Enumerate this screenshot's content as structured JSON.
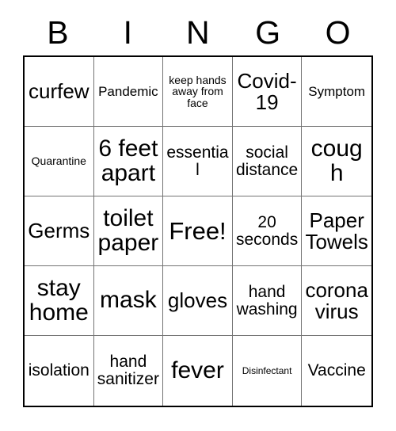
{
  "header": {
    "letters": [
      "B",
      "I",
      "N",
      "G",
      "O"
    ]
  },
  "grid": {
    "rows": 5,
    "columns": 5,
    "border_color": "#000000",
    "gridline_color": "#737373",
    "background": "#ffffff",
    "text_color": "#000000",
    "cells": [
      {
        "text": "curfew",
        "size": "s-lg"
      },
      {
        "text": "Pandemic",
        "size": "s-sm"
      },
      {
        "text": "keep hands away from face",
        "size": "s-xs"
      },
      {
        "text": "Covid-19",
        "size": "s-lg"
      },
      {
        "text": "Symptom",
        "size": "s-sm"
      },
      {
        "text": "Quarantine",
        "size": "s-xs"
      },
      {
        "text": "6 feet apart",
        "size": "s-xl"
      },
      {
        "text": "essential",
        "size": "s-md"
      },
      {
        "text": "social distance",
        "size": "s-md"
      },
      {
        "text": "cough",
        "size": "s-xl"
      },
      {
        "text": "Germs",
        "size": "s-lg"
      },
      {
        "text": "toilet paper",
        "size": "s-xl"
      },
      {
        "text": "Free!",
        "size": "s-free"
      },
      {
        "text": "20 seconds",
        "size": "s-md"
      },
      {
        "text": "Paper Towels",
        "size": "s-lg"
      },
      {
        "text": "stay home",
        "size": "s-xl"
      },
      {
        "text": "mask",
        "size": "s-xl"
      },
      {
        "text": "gloves",
        "size": "s-lg"
      },
      {
        "text": "hand washing",
        "size": "s-md"
      },
      {
        "text": "corona virus",
        "size": "s-lg"
      },
      {
        "text": "isolation",
        "size": "s-md"
      },
      {
        "text": "hand sanitizer",
        "size": "s-md"
      },
      {
        "text": "fever",
        "size": "s-xl"
      },
      {
        "text": "Disinfectant",
        "size": "s-xxs"
      },
      {
        "text": "Vaccine",
        "size": "s-md"
      }
    ]
  }
}
